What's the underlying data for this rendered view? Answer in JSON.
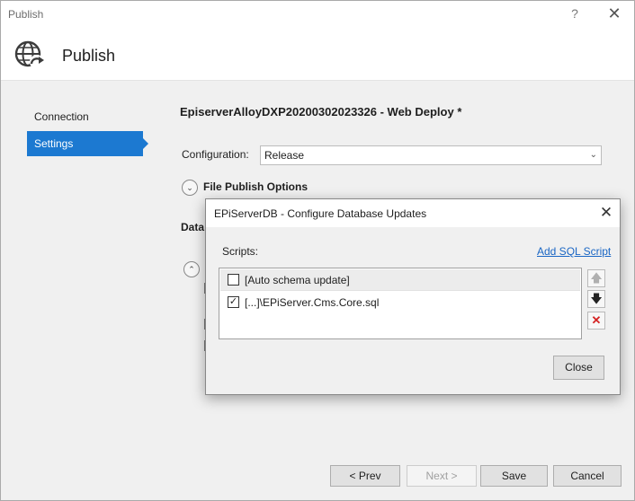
{
  "window": {
    "title": "Publish",
    "help_glyph": "?",
    "close_glyph": "✕"
  },
  "header": {
    "title": "Publish",
    "icon": "publish-globe-icon"
  },
  "nav": {
    "items": [
      {
        "label": "Connection",
        "selected": false
      },
      {
        "label": "Settings",
        "selected": true
      }
    ]
  },
  "settings": {
    "profile_title": "EpiserverAlloyDXP20200302023326 - Web Deploy *",
    "configuration_label": "Configuration:",
    "configuration_value": "Release",
    "file_publish_options_label": "File Publish Options",
    "databases_label": "Data"
  },
  "dialog": {
    "title": "EPiServerDB - Configure Database Updates",
    "close_glyph": "✕",
    "scripts_label": "Scripts:",
    "add_sql_link": "Add SQL Script",
    "scripts": [
      {
        "label": "[Auto schema update]",
        "checked": false,
        "check_glyph": ""
      },
      {
        "label": "[...]\\EPiServer.Cms.Core.sql",
        "checked": true,
        "check_glyph": "✓"
      }
    ],
    "move_up_glyph": "🡅",
    "move_down_glyph": "🡇",
    "remove_glyph": "✕",
    "close_button": "Close"
  },
  "footer": {
    "prev": "< Prev",
    "next": "Next >",
    "save": "Save",
    "cancel": "Cancel"
  },
  "colors": {
    "accent": "#1c79d1",
    "link": "#1a66c4",
    "delete": "#d42323"
  }
}
